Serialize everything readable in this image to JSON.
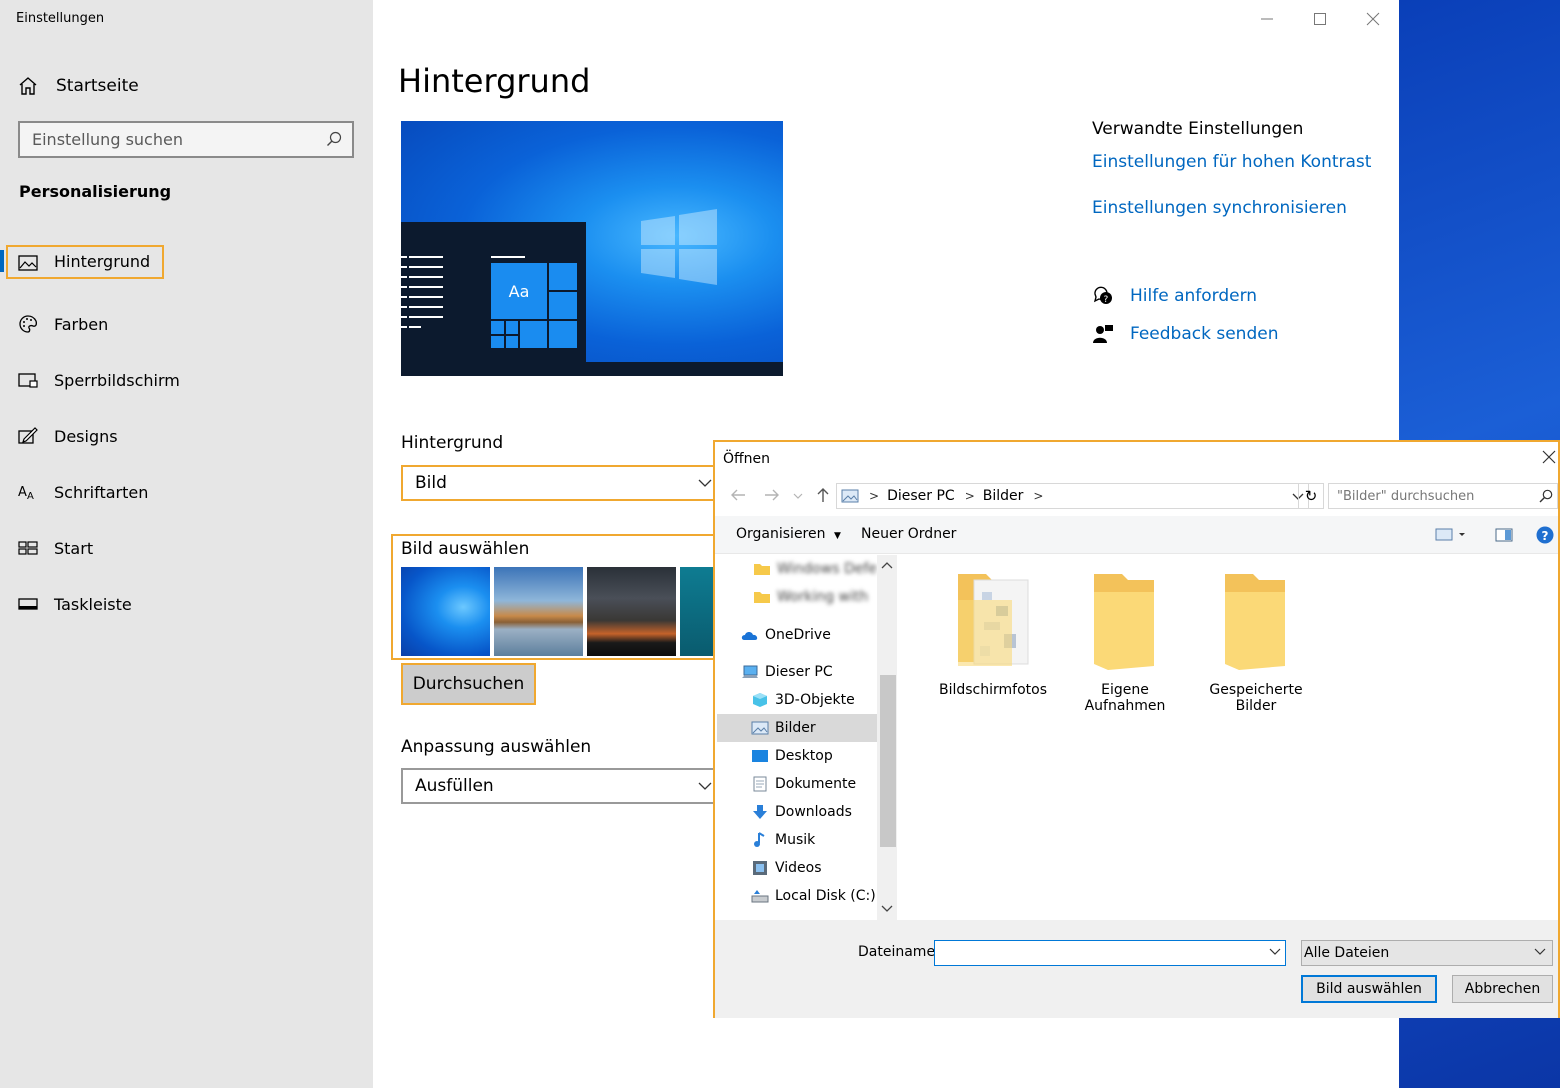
{
  "window": {
    "title": "Einstellungen"
  },
  "sidebar": {
    "home": "Startseite",
    "search_placeholder": "Einstellung suchen",
    "section": "Personalisierung",
    "items": [
      {
        "label": "Hintergrund",
        "icon": "picture-icon",
        "active": true
      },
      {
        "label": "Farben",
        "icon": "palette-icon"
      },
      {
        "label": "Sperrbildschirm",
        "icon": "lockscreen-icon"
      },
      {
        "label": "Designs",
        "icon": "designs-icon"
      },
      {
        "label": "Schriftarten",
        "icon": "fonts-icon"
      },
      {
        "label": "Start",
        "icon": "start-icon"
      },
      {
        "label": "Taskleiste",
        "icon": "taskbar-icon"
      }
    ]
  },
  "main": {
    "title": "Hintergrund",
    "preview_tile_text": "Aa",
    "background_label": "Hintergrund",
    "background_value": "Bild",
    "choose_picture_label": "Bild auswählen",
    "browse_button": "Durchsuchen",
    "fit_label": "Anpassung auswählen",
    "fit_value": "Ausfüllen"
  },
  "related": {
    "header": "Verwandte Einstellungen",
    "link_contrast": "Einstellungen für hohen Kontrast",
    "link_sync": "Einstellungen synchronisieren",
    "help": "Hilfe anfordern",
    "feedback": "Feedback senden"
  },
  "dialog": {
    "title": "Öffnen",
    "breadcrumb": [
      "Dieser PC",
      "Bilder"
    ],
    "search_placeholder": "\"Bilder\" durchsuchen",
    "toolbar": {
      "organize": "Organisieren",
      "new_folder": "Neuer Ordner"
    },
    "nav": [
      {
        "label": "Windows Defe",
        "blurred": true
      },
      {
        "label": "Working with",
        "blurred": true
      },
      {
        "label": "OneDrive"
      },
      {
        "label": "Dieser PC"
      },
      {
        "label": "3D-Objekte"
      },
      {
        "label": "Bilder",
        "selected": true
      },
      {
        "label": "Desktop"
      },
      {
        "label": "Dokumente"
      },
      {
        "label": "Downloads"
      },
      {
        "label": "Musik"
      },
      {
        "label": "Videos"
      },
      {
        "label": "Local Disk (C:)"
      }
    ],
    "files": [
      {
        "line1": "Bildschirmfotos",
        "line2": ""
      },
      {
        "line1": "Eigene",
        "line2": "Aufnahmen"
      },
      {
        "line1": "Gespeicherte",
        "line2": "Bilder"
      }
    ],
    "filename_label": "Dateiname:",
    "filename_value": "",
    "filter_value": "Alle Dateien",
    "ok_button": "Bild auswählen",
    "cancel_button": "Abbrechen"
  },
  "colors": {
    "accent": "#0067c0",
    "highlight": "#f0a830"
  }
}
